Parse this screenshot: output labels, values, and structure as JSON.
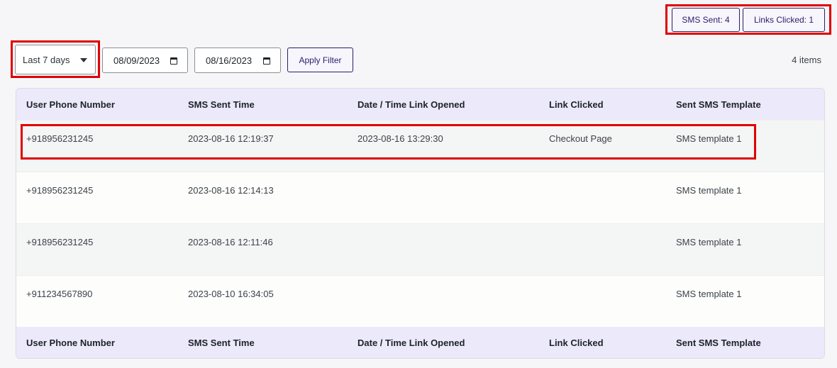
{
  "stats": {
    "sms_sent": "SMS Sent: 4",
    "links_clicked": "Links Clicked: 1"
  },
  "filters": {
    "range_selected": "Last 7 days",
    "start_date": "08/09/2023",
    "end_date": "08/16/2023",
    "apply_label": "Apply Filter",
    "items_count": "4 items"
  },
  "table": {
    "columns": [
      "User Phone Number",
      "SMS Sent Time",
      "Date / Time Link Opened",
      "Link Clicked",
      "Sent SMS Template"
    ],
    "rows": [
      [
        "+918956231245",
        "2023-08-16 12:19:37",
        "2023-08-16 13:29:30",
        "Checkout Page",
        "SMS template 1"
      ],
      [
        "+918956231245",
        "2023-08-16 12:14:13",
        "",
        "",
        "SMS template 1"
      ],
      [
        "+918956231245",
        "2023-08-16 12:11:46",
        "",
        "",
        "SMS template 1"
      ],
      [
        "+911234567890",
        "2023-08-10 16:34:05",
        "",
        "",
        "SMS template 1"
      ]
    ]
  },
  "colors": {
    "accent": "#2c1d6b",
    "header_bg": "#ece9fb",
    "row_alt_bg": "#f4f5f5",
    "highlight": "#e00000"
  }
}
